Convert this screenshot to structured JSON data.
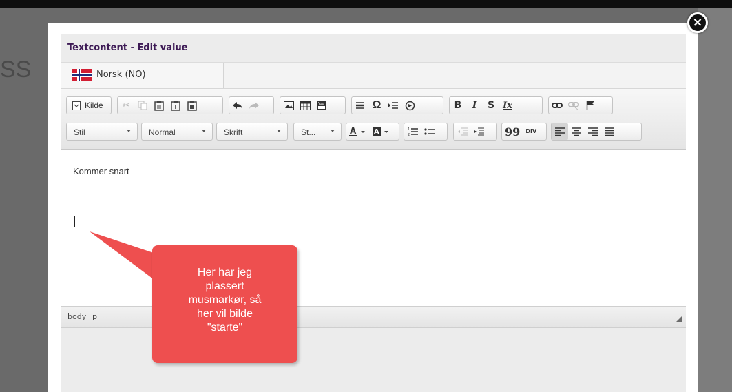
{
  "background": {
    "partial_text": "SS"
  },
  "dialog": {
    "title": "Textcontent - Edit value",
    "close_symbol": "×"
  },
  "language_tab": {
    "label": "Norsk (NO)",
    "flag_icon": "norway-flag-icon"
  },
  "toolbar": {
    "source_label": "Kilde",
    "styles_combo": "Stil",
    "format_combo": "Normal",
    "font_combo": "Skrift",
    "size_combo": "St...",
    "bold": "B",
    "italic": "I",
    "strike": "S",
    "remove_format": "Ix",
    "blockquote": "99",
    "div": "DIV",
    "special_char": "Ω"
  },
  "editor": {
    "text": "Kommer snart"
  },
  "elements_path": {
    "items": [
      "body",
      "p"
    ]
  },
  "callout": {
    "text": "Her har jeg\nplassert\nmusmarkør, så\nher vil bilde\n\"starte\"",
    "color": "#ee4f4f"
  }
}
